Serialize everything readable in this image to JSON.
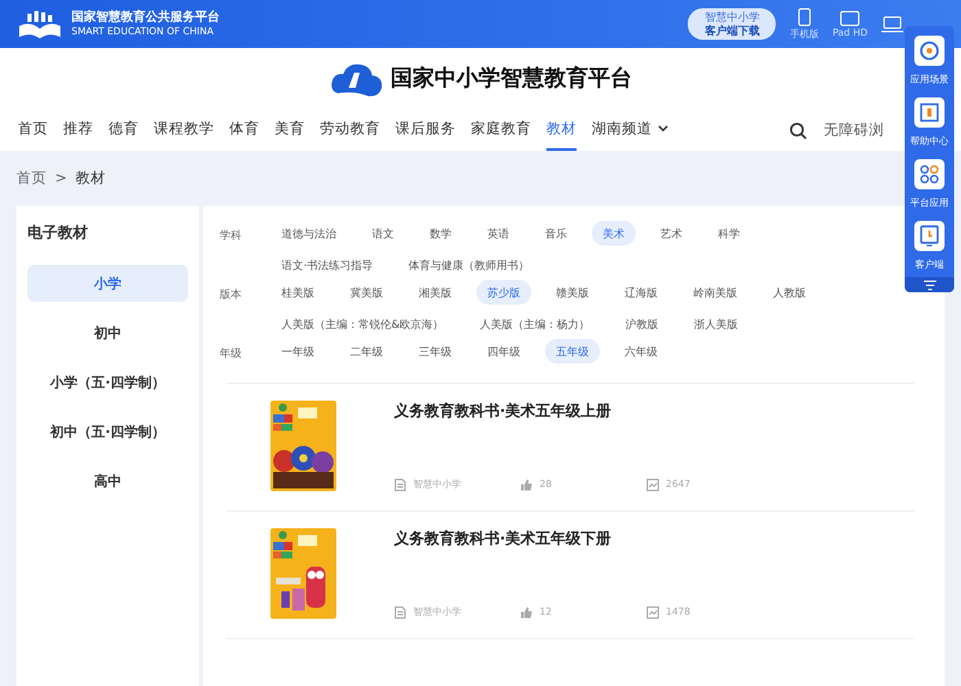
{
  "top_bar": {
    "brand_cn": "国家智慧教育公共服务平台",
    "brand_en": "SMART EDUCATION OF CHINA",
    "download_button": [
      "智慧中小学",
      "客户端下载"
    ],
    "devices": [
      {
        "kind": "phone",
        "label": "手机版"
      },
      {
        "kind": "pad",
        "label": "Pad HD"
      },
      {
        "kind": "laptop"
      }
    ]
  },
  "site_title": "国家中小学智慧教育平台",
  "nav": {
    "items": [
      {
        "label": "首页",
        "selected": false
      },
      {
        "label": "推荐",
        "selected": false
      },
      {
        "label": "德育",
        "selected": false
      },
      {
        "label": "课程教学",
        "selected": false
      },
      {
        "label": "体育",
        "selected": false
      },
      {
        "label": "美育",
        "selected": false
      },
      {
        "label": "劳动教育",
        "selected": false
      },
      {
        "label": "课后服务",
        "selected": false
      },
      {
        "label": "家庭教育",
        "selected": false
      },
      {
        "label": "教材",
        "selected": true
      },
      {
        "label": "湖南频道",
        "selected": false,
        "dropdown": true
      }
    ],
    "accessibility": "无障碍浏"
  },
  "breadcrumb": [
    "首页",
    ">",
    "教材"
  ],
  "sidebar": {
    "title": "电子教材",
    "items": [
      {
        "label": "小学",
        "selected": true
      },
      {
        "label": "初中",
        "selected": false
      },
      {
        "label": "小学（五·四学制）",
        "selected": false
      },
      {
        "label": "初中（五·四学制）",
        "selected": false
      },
      {
        "label": "高中",
        "selected": false
      }
    ]
  },
  "filters": [
    {
      "label": "学科",
      "options": [
        {
          "label": "道德与法治",
          "selected": false
        },
        {
          "label": "语文",
          "selected": false
        },
        {
          "label": "数学",
          "selected": false
        },
        {
          "label": "英语",
          "selected": false
        },
        {
          "label": "音乐",
          "selected": false
        },
        {
          "label": "美术",
          "selected": true
        },
        {
          "label": "艺术",
          "selected": false
        },
        {
          "label": "科学",
          "selected": false
        },
        {
          "label": "语文·书法练习指导",
          "selected": false
        },
        {
          "label": "体育与健康（教师用书）",
          "selected": false
        }
      ]
    },
    {
      "label": "版本",
      "options": [
        {
          "label": "桂美版",
          "selected": false
        },
        {
          "label": "冀美版",
          "selected": false
        },
        {
          "label": "湘美版",
          "selected": false
        },
        {
          "label": "苏少版",
          "selected": true
        },
        {
          "label": "赣美版",
          "selected": false
        },
        {
          "label": "辽海版",
          "selected": false
        },
        {
          "label": "岭南美版",
          "selected": false
        },
        {
          "label": "人教版",
          "selected": false
        },
        {
          "label": "人美版（主编：常锐伦&欧京海）",
          "selected": false
        },
        {
          "label": "人美版（主编：杨力）",
          "selected": false
        },
        {
          "label": "沪教版",
          "selected": false
        },
        {
          "label": "浙人美版",
          "selected": false
        }
      ]
    },
    {
      "label": "年级",
      "options": [
        {
          "label": "一年级",
          "selected": false
        },
        {
          "label": "二年级",
          "selected": false
        },
        {
          "label": "三年级",
          "selected": false
        },
        {
          "label": "四年级",
          "selected": false
        },
        {
          "label": "五年级",
          "selected": true
        },
        {
          "label": "六年级",
          "selected": false
        }
      ]
    }
  ],
  "books": [
    {
      "title": "义务教育教科书·美术五年级上册",
      "publisher": "智慧中小学",
      "likes": "28",
      "views": "2647"
    },
    {
      "title": "义务教育教科书·美术五年级下册",
      "publisher": "智慧中小学",
      "likes": "12",
      "views": "1478"
    }
  ],
  "float_panel": [
    {
      "kind": "scene",
      "label": "应用场景"
    },
    {
      "kind": "help",
      "label": "帮助中心"
    },
    {
      "kind": "apps",
      "label": "平台应用"
    },
    {
      "kind": "client",
      "label": "客户端"
    }
  ]
}
